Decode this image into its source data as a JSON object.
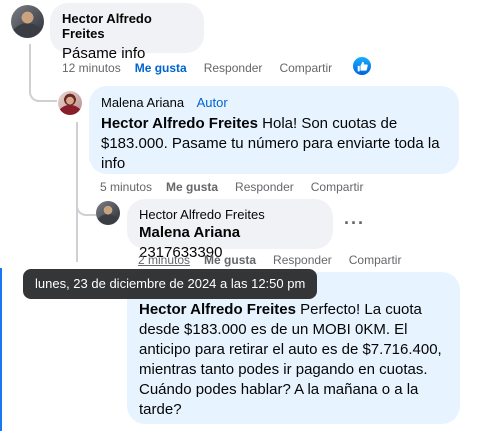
{
  "comments": [
    {
      "author": "Hector Alfredo Freites",
      "text": "Pásame info",
      "time": "12 minutos",
      "like": "Me gusta",
      "reply": "Responder",
      "share": "Compartir"
    },
    {
      "author": "Malena Ariana",
      "badge": "Autor",
      "mention": "Hector Alfredo Freites",
      "text": " Hola! Son cuotas de $183.000. Pasame tu número para enviarte toda la info",
      "time": "5 minutos",
      "like": "Me gusta",
      "reply": "Responder",
      "share": "Compartir"
    },
    {
      "author": "Hector Alfredo Freites",
      "mention": "Malena Ariana",
      "text": " 2317633390",
      "time": "2 minutos",
      "like": "Me gusta",
      "reply": "Responder",
      "share": "Compartir",
      "more": "···"
    },
    {
      "mention": "Hector Alfredo Freites",
      "text": " Perfecto! La cuota desde $183.000 es de un MOBI 0KM. El anticipo para retirar el auto es de $7.716.400, mientras tanto podes ir pagando en cuotas. Cuándo podes hablar? A la mañana o a la tarde?"
    }
  ],
  "tooltip": "lunes, 23 de diciembre de 2024 a las 12:50 pm",
  "colors": {
    "accent": "#0064d1",
    "bubble_grey": "#f0f2f5",
    "bubble_blue": "#e7f3ff",
    "meta": "#65676b"
  },
  "icons": {
    "like_reaction": "thumbs-up-icon",
    "more": "more-options-icon"
  }
}
